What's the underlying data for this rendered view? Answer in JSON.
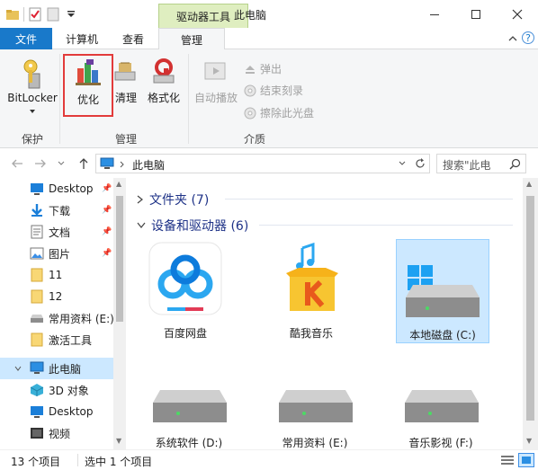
{
  "window": {
    "contextual_tab_label": "驱动器工具",
    "title": "此电脑",
    "minimize_icon": "minimize-icon",
    "maximize_icon": "maximize-icon",
    "close_icon": "close-icon"
  },
  "tabs": {
    "file": "文件",
    "computer": "计算机",
    "view": "查看",
    "manage": "管理"
  },
  "ribbon": {
    "protect": {
      "bitlocker_label": "BitLocker",
      "group_label": "保护"
    },
    "manage": {
      "optimize_label": "优化",
      "cleanup_label": "清理",
      "format_label": "格式化",
      "group_label": "管理"
    },
    "media": {
      "autoplay_label": "自动播放",
      "eject_label": "弹出",
      "finish_burn_label": "结束刻录",
      "erase_disc_label": "擦除此光盘",
      "group_label": "介质"
    }
  },
  "address": {
    "path_label": "此电脑",
    "search_placeholder": "搜索\"此电"
  },
  "sidebar": {
    "items": [
      {
        "label": "Desktop",
        "icon": "desktop-icon",
        "pinned": true
      },
      {
        "label": "下载",
        "icon": "download-icon",
        "pinned": true
      },
      {
        "label": "文档",
        "icon": "documents-icon",
        "pinned": true
      },
      {
        "label": "图片",
        "icon": "pictures-icon",
        "pinned": true
      },
      {
        "label": "11",
        "icon": "folder-icon",
        "pinned": false
      },
      {
        "label": "12",
        "icon": "folder-icon",
        "pinned": false
      },
      {
        "label": "常用资料 (E:)",
        "icon": "drive-icon",
        "pinned": false
      },
      {
        "label": "激活工具",
        "icon": "folder-icon",
        "pinned": false
      },
      {
        "label": "此电脑",
        "icon": "this-pc-icon",
        "pinned": false,
        "selected": true
      },
      {
        "label": "3D 对象",
        "icon": "3d-objects-icon",
        "pinned": false
      },
      {
        "label": "Desktop",
        "icon": "desktop-icon",
        "pinned": false
      },
      {
        "label": "视频",
        "icon": "videos-icon",
        "pinned": false
      }
    ]
  },
  "content": {
    "folders_header": "文件夹 (7)",
    "devices_header": "设备和驱动器 (6)",
    "drives": [
      {
        "label": "百度网盘",
        "icon": "baidu-netdisk-icon"
      },
      {
        "label": "酷我音乐",
        "icon": "kuwo-music-icon"
      },
      {
        "label": "本地磁盘 (C:)",
        "icon": "windows-drive-icon",
        "selected": true
      },
      {
        "label": "系统软件 (D:)",
        "icon": "drive-icon"
      },
      {
        "label": "常用资料 (E:)",
        "icon": "drive-icon"
      },
      {
        "label": "音乐影视 (F:)",
        "icon": "drive-icon"
      }
    ]
  },
  "status": {
    "item_count": "13 个项目",
    "selection": "选中 1 个项目"
  },
  "colors": {
    "accent": "#1979ca",
    "contextual_tab": "#dfeec0",
    "highlight_box": "#e23b3b",
    "selection": "#cce8ff"
  }
}
